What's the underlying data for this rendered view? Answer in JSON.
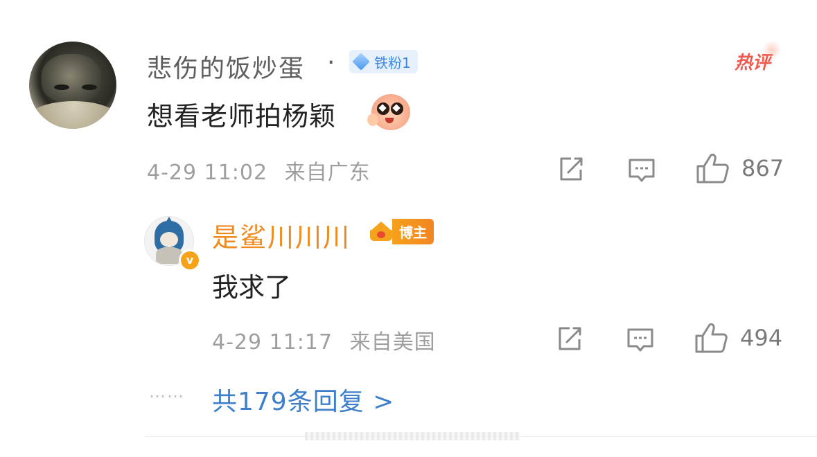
{
  "comment": {
    "username": "悲伤的饭炒蛋",
    "separator": "·",
    "fan_badge": "铁粉1",
    "hot_tag": "热评",
    "text": "想看老师拍杨颖",
    "time": "4-29 11:02",
    "location": "来自广东",
    "likes": "867",
    "icons": {
      "repost": "share-icon",
      "comment": "comment-icon",
      "like": "thumbs-up-icon"
    }
  },
  "reply": {
    "username": "是鲨川川川",
    "role_badge": "博主",
    "verify_mark": "v",
    "text": "我求了",
    "time": "4-29 11:17",
    "location": "来自美国",
    "likes": "494"
  },
  "more": {
    "dots": "……",
    "label": "共179条回复 >"
  },
  "colors": {
    "username_gray": "#5e5e5e",
    "blogger_orange": "#ef8a1e",
    "link_blue": "#3d7fcb",
    "hot_red": "#f05a4f",
    "meta_gray": "#9e9e9e"
  }
}
